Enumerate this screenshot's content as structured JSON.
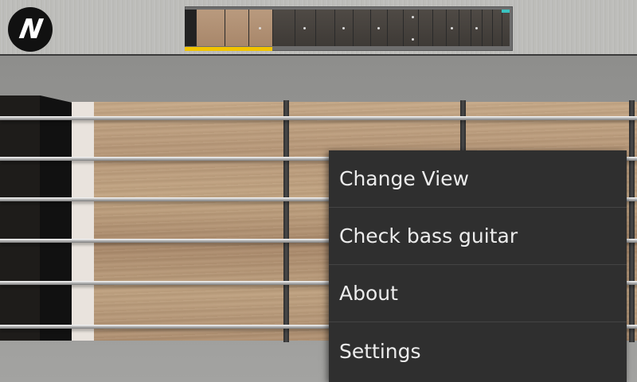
{
  "app": {
    "logo_letter": "N"
  },
  "overview": {
    "selected_region": "first frets",
    "end_marker_color": "#3bc3c0",
    "selection_color": "#f2c400"
  },
  "menu": {
    "items": [
      {
        "label": "Change View"
      },
      {
        "label": "Check bass guitar"
      },
      {
        "label": "About"
      },
      {
        "label": "Settings"
      }
    ]
  }
}
